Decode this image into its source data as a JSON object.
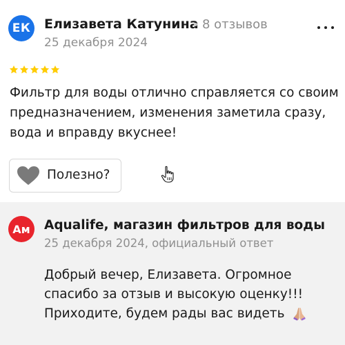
{
  "review": {
    "avatar_initials": "ЕК",
    "author": "Елизавета Катунина",
    "reviews_count": "8 отзывов",
    "date": "25 декабря 2024",
    "rating": 5,
    "text": "Фильтр для воды отлично справляется со своим предназначением, изменения заметила сразу, вода и вправду вкуснее!",
    "helpful_label": "Полезно?",
    "more_icon": "more-dots-icon"
  },
  "reply": {
    "avatar_initials": "Ам",
    "org_name": "Aqualife, магазин фильтров для воды",
    "meta": "25 декабря 2024, официальный ответ",
    "text": "Добрый вечер, Елизавета. Огромное спасибо за отзыв и высокую оценку!!! Приходите, будем рады вас видеть",
    "emoji": "pray-hands-icon"
  },
  "colors": {
    "star": "#ffcc00",
    "user_avatar": "#1a73e8",
    "org_avatar": "#e8242c",
    "reply_background": "#f2f2f2",
    "heart": "#7a7a7a"
  }
}
